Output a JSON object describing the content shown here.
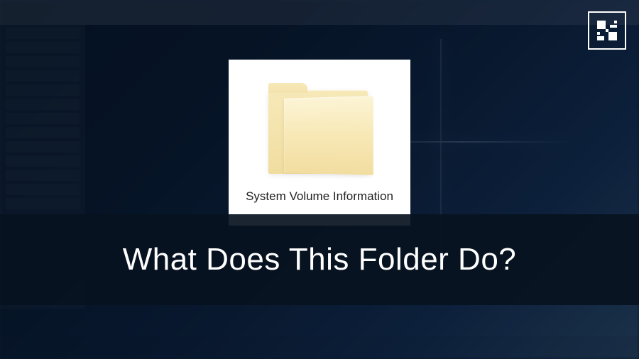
{
  "folder": {
    "name": "System Volume Information"
  },
  "headline": "What Does This Folder Do?",
  "logo": {
    "name": "fossbytes-logo"
  },
  "colors": {
    "band_bg": "#081220",
    "card_bg": "#ffffff",
    "folder_fill": "#f5e5ad",
    "text_light": "#ffffff",
    "text_dark": "#222222"
  }
}
